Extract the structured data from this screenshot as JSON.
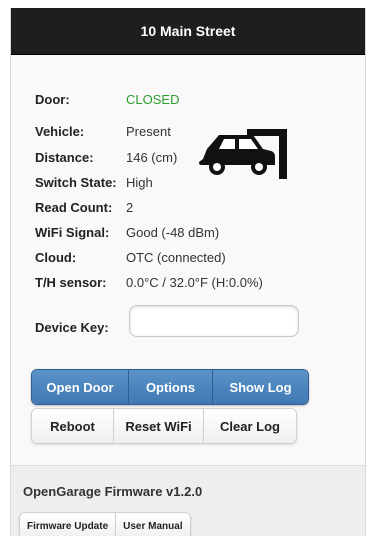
{
  "header": {
    "title": "10 Main Street"
  },
  "status": [
    {
      "label": "Door:",
      "value": "CLOSED"
    },
    {
      "label": "Vehicle:",
      "value": "Present"
    },
    {
      "label": "Distance:",
      "value": "146 (cm)"
    },
    {
      "label": "Switch State:",
      "value": "High"
    },
    {
      "label": "Read Count:",
      "value": "2"
    },
    {
      "label": "WiFi Signal:",
      "value": "Good (-48 dBm)"
    },
    {
      "label": "Cloud:",
      "value": "OTC (connected)"
    },
    {
      "label": "T/H sensor:",
      "value": "0.0°C / 32.0°F (H:0.0%)"
    }
  ],
  "device_key": {
    "label": "Device Key:",
    "value": ""
  },
  "primary_buttons": [
    "Open Door",
    "Options",
    "Show Log"
  ],
  "secondary_buttons": [
    "Reboot",
    "Reset WiFi",
    "Clear Log"
  ],
  "footer": {
    "firmware": "OpenGarage Firmware v1.2.0",
    "links": [
      "Firmware Update",
      "User Manual"
    ]
  },
  "colors": {
    "door_closed": "#2e9c2e",
    "accent": "#3f78b3"
  },
  "icons": {
    "status_graphic": "car-in-garage-icon"
  }
}
